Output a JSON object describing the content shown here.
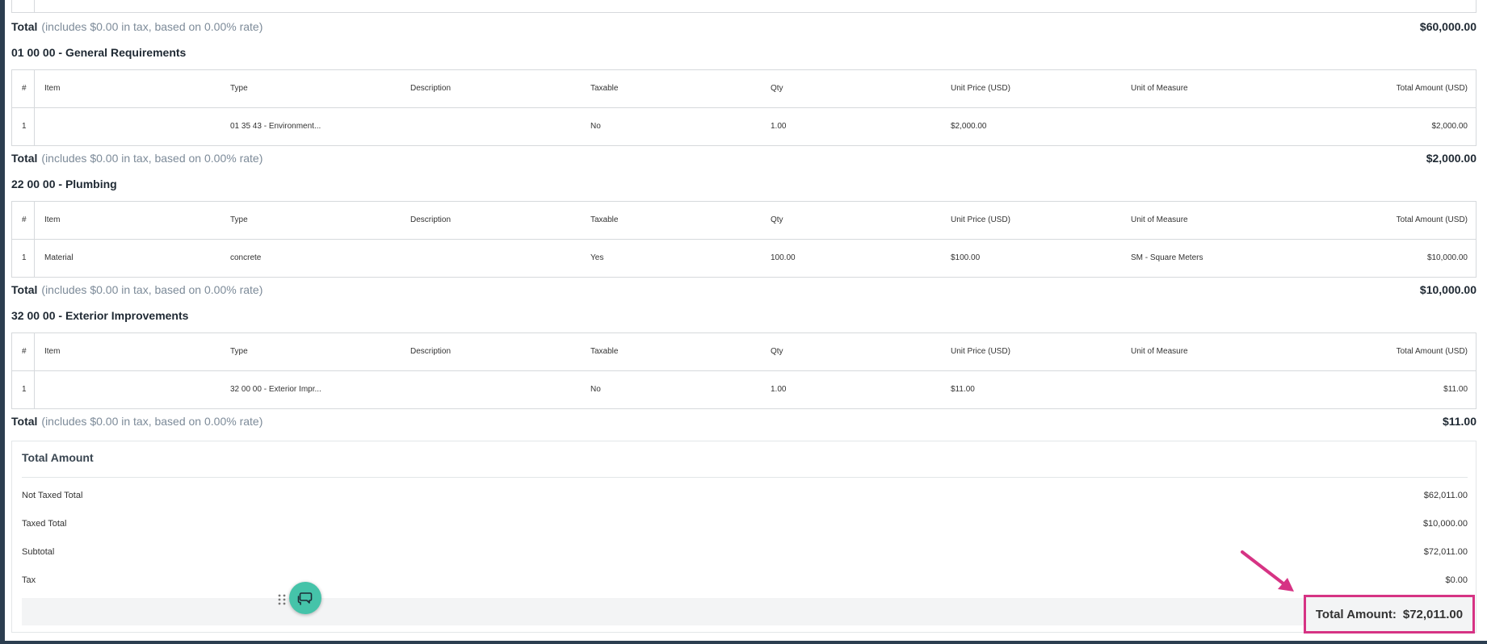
{
  "sections": [
    {
      "total": {
        "label": "Total",
        "note": "(includes $0.00 in tax, based on 0.00% rate)",
        "amount": "$60,000.00"
      }
    },
    {
      "title": "01 00 00 - General Requirements",
      "headers": [
        "#",
        "Item",
        "Type",
        "Description",
        "Taxable",
        "Qty",
        "Unit Price (USD)",
        "Unit of Measure",
        "Total Amount (USD)"
      ],
      "row": {
        "num": "1",
        "item": "",
        "type": "01 35 43 - Environment...",
        "description": "",
        "taxable": "No",
        "qty": "1.00",
        "unit_price": "$2,000.00",
        "uom": "",
        "total": "$2,000.00"
      },
      "total": {
        "label": "Total",
        "note": "(includes $0.00 in tax, based on 0.00% rate)",
        "amount": "$2,000.00"
      }
    },
    {
      "title": "22 00 00 - Plumbing",
      "headers": [
        "#",
        "Item",
        "Type",
        "Description",
        "Taxable",
        "Qty",
        "Unit Price (USD)",
        "Unit of Measure",
        "Total Amount (USD)"
      ],
      "row": {
        "num": "1",
        "item": "Material",
        "type": "concrete",
        "description": "",
        "taxable": "Yes",
        "qty": "100.00",
        "unit_price": "$100.00",
        "uom": "SM - Square Meters",
        "total": "$10,000.00"
      },
      "total": {
        "label": "Total",
        "note": "(includes $0.00 in tax, based on 0.00% rate)",
        "amount": "$10,000.00"
      }
    },
    {
      "title": "32 00 00 - Exterior Improvements",
      "headers": [
        "#",
        "Item",
        "Type",
        "Description",
        "Taxable",
        "Qty",
        "Unit Price (USD)",
        "Unit of Measure",
        "Total Amount (USD)"
      ],
      "row": {
        "num": "1",
        "item": "",
        "type": "32 00 00 - Exterior Impr...",
        "description": "",
        "taxable": "No",
        "qty": "1.00",
        "unit_price": "$11.00",
        "uom": "",
        "total": "$11.00"
      },
      "total": {
        "label": "Total",
        "note": "(includes $0.00 in tax, based on 0.00% rate)",
        "amount": "$11.00"
      }
    }
  ],
  "summary": {
    "title": "Total Amount",
    "not_taxed_label": "Not Taxed Total",
    "not_taxed_value": "$62,011.00",
    "taxed_label": "Taxed Total",
    "taxed_value": "$10,000.00",
    "subtotal_label": "Subtotal",
    "subtotal_value": "$72,011.00",
    "tax_label": "Tax",
    "tax_value": "$0.00",
    "grand_label": "Total Amount:",
    "grand_value": "$72,011.00"
  },
  "colors": {
    "highlight": "#d63384",
    "chat_button": "#45c3a9"
  },
  "icons": {
    "chat": "chat-bubbles-icon",
    "drag": "drag-handle-icon",
    "arrow": "annotation-arrow"
  }
}
